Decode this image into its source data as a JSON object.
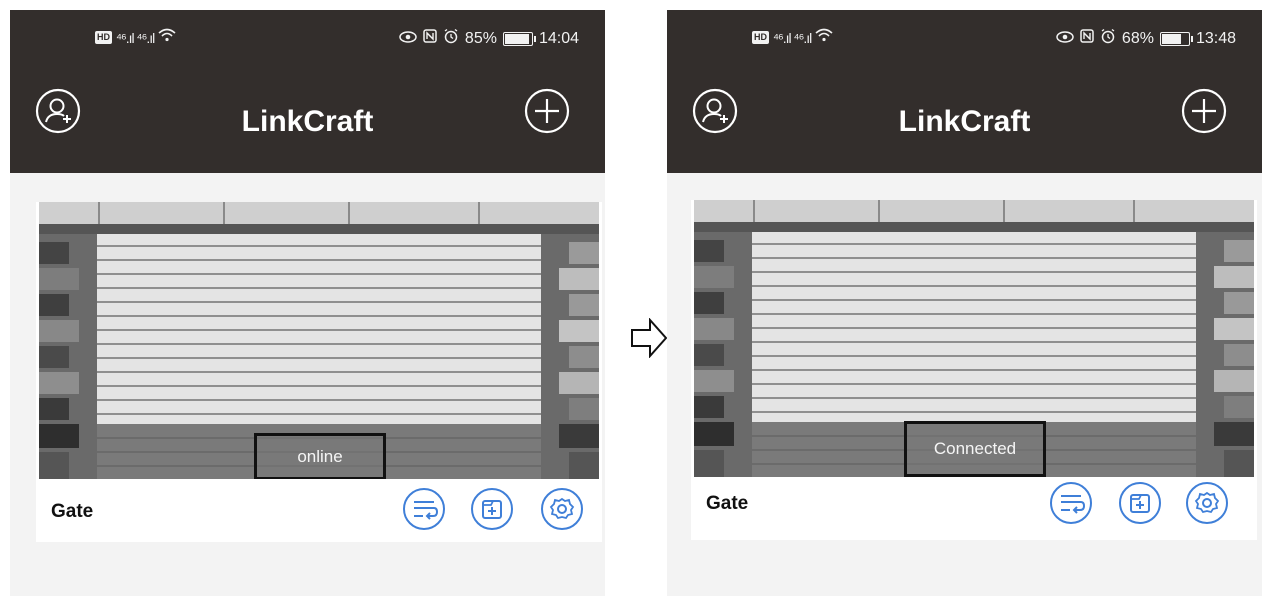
{
  "screens": [
    {
      "status": {
        "battery": "85%",
        "time": "14:04",
        "battery_level": 0.85
      },
      "app_title": "LinkCraft",
      "device": {
        "name": "Gate",
        "state_label": "online"
      }
    },
    {
      "status": {
        "battery": "68%",
        "time": "13:48",
        "battery_level": 0.68
      },
      "app_title": "LinkCraft",
      "device": {
        "name": "Gate",
        "state_label": "Connected"
      }
    }
  ],
  "colors": {
    "header": "#332e2c",
    "accent": "#3f7fd8",
    "background": "#f3f3f3"
  }
}
